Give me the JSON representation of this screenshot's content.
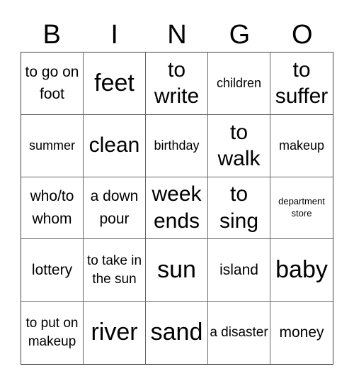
{
  "header": {
    "letters": [
      "B",
      "I",
      "N",
      "G",
      "O"
    ]
  },
  "cells": [
    [
      "to go on foot",
      "feet",
      "to write",
      "children",
      "to suffer"
    ],
    [
      "summer",
      "clean",
      "birthday",
      "to walk",
      "makeup"
    ],
    [
      "who/to whom",
      "a down pour",
      "week ends",
      "to sing",
      "department store"
    ],
    [
      "lottery",
      "to take in the sun",
      "sun",
      "island",
      "baby"
    ],
    [
      "to put on makeup",
      "river",
      "sand",
      "a disaster",
      "money"
    ]
  ]
}
